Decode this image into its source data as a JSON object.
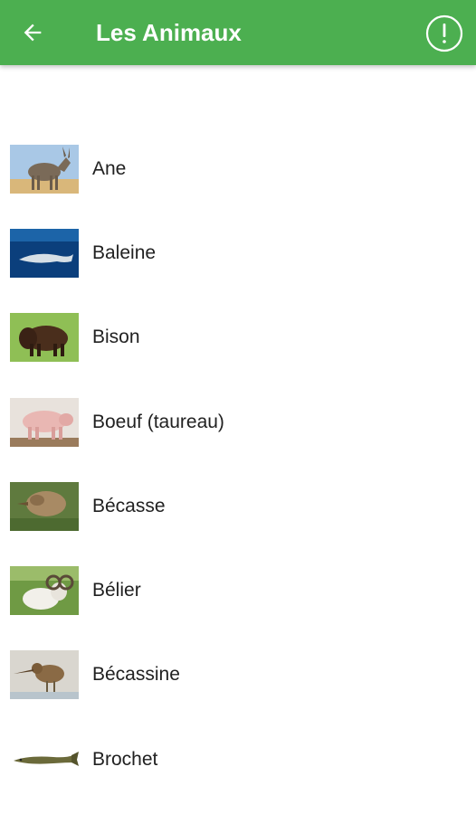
{
  "header": {
    "title": "Les Animaux",
    "back_icon": "arrow-left-icon",
    "info_icon": "exclamation-circle-icon",
    "color": "#4caf50"
  },
  "animals": [
    {
      "label": "Ane",
      "image": "donkey"
    },
    {
      "label": "Baleine",
      "image": "whale"
    },
    {
      "label": "Bison",
      "image": "bison"
    },
    {
      "label": "Boeuf (taureau)",
      "image": "bull"
    },
    {
      "label": "Bécasse",
      "image": "woodcock"
    },
    {
      "label": "Bélier",
      "image": "ram"
    },
    {
      "label": "Bécassine",
      "image": "snipe"
    },
    {
      "label": "Brochet",
      "image": "pike"
    }
  ]
}
